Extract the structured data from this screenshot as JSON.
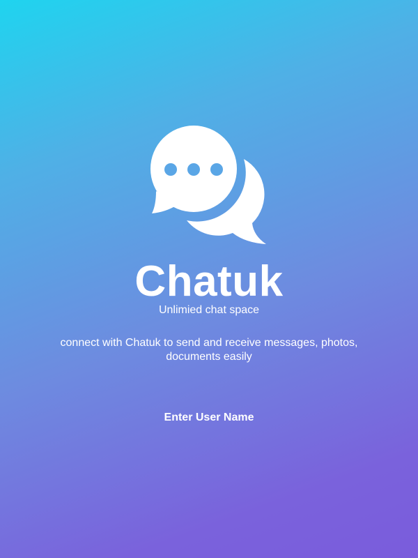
{
  "app": {
    "name": "Chatuk",
    "tagline": "Unlimied chat space",
    "description": "connect with Chatuk to send and receive messages, photos, documents easily"
  },
  "actions": {
    "username_label": "Enter User Name"
  },
  "logo": {
    "icon": "chat-bubbles-icon",
    "bubble_color": "#ffffff",
    "dot_color": "#5aa6e6"
  },
  "colors": {
    "gradient_start": "#1fd4ef",
    "gradient_end": "#7a5cdc",
    "text": "#ffffff"
  }
}
